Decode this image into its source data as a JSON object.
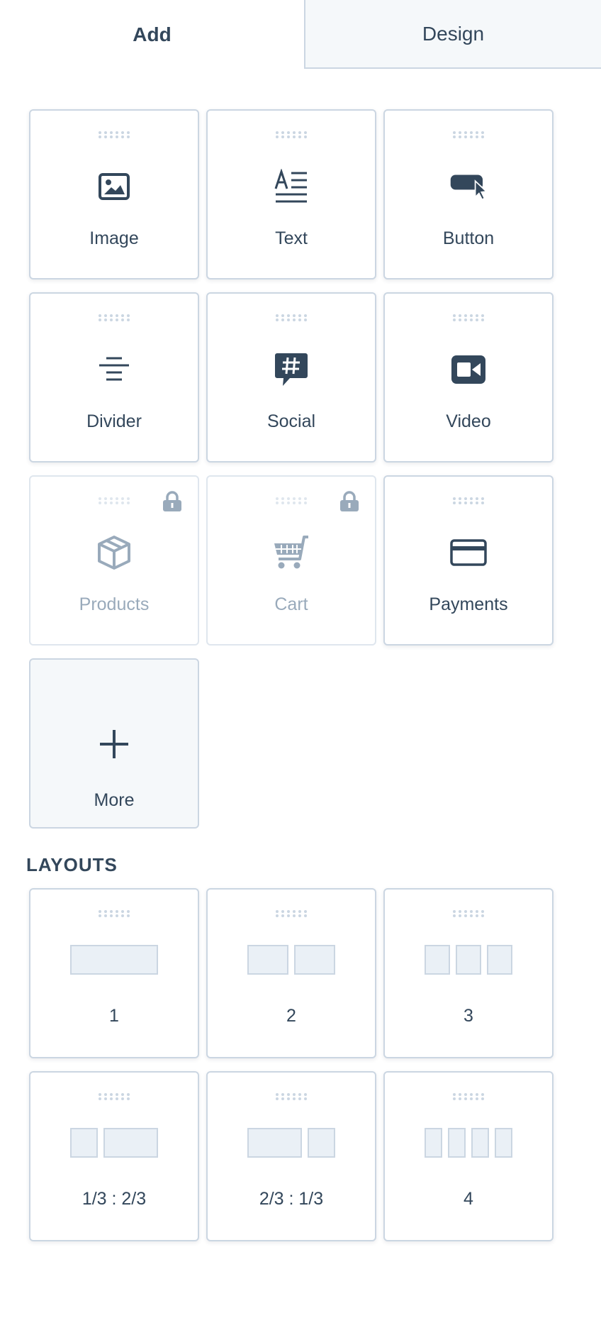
{
  "tabs": [
    {
      "label": "Add",
      "active": true
    },
    {
      "label": "Design",
      "active": false
    }
  ],
  "modules": [
    {
      "label": "Image",
      "icon": "image-icon",
      "locked": false
    },
    {
      "label": "Text",
      "icon": "text-icon",
      "locked": false
    },
    {
      "label": "Button",
      "icon": "button-icon",
      "locked": false
    },
    {
      "label": "Divider",
      "icon": "divider-icon",
      "locked": false
    },
    {
      "label": "Social",
      "icon": "social-hashtag-icon",
      "locked": false
    },
    {
      "label": "Video",
      "icon": "video-camera-icon",
      "locked": false
    },
    {
      "label": "Products",
      "icon": "product-box-icon",
      "locked": true
    },
    {
      "label": "Cart",
      "icon": "shopping-cart-icon",
      "locked": true
    },
    {
      "label": "Payments",
      "icon": "credit-card-icon",
      "locked": false
    }
  ],
  "more": {
    "label": "More",
    "icon": "plus-icon"
  },
  "layouts_title": "LAYOUTS",
  "layouts": [
    {
      "label": "1",
      "columns": [
        1
      ]
    },
    {
      "label": "2",
      "columns": [
        1,
        1
      ]
    },
    {
      "label": "3",
      "columns": [
        1,
        1,
        1
      ]
    },
    {
      "label": "1/3 : 2/3",
      "columns": [
        1,
        2
      ]
    },
    {
      "label": "2/3 : 1/3",
      "columns": [
        2,
        1
      ]
    },
    {
      "label": "4",
      "columns": [
        1,
        1,
        1,
        1
      ]
    }
  ],
  "colors": {
    "text": "#33475b",
    "border": "#cbd6e2",
    "muted": "#99aabb",
    "preview_fill": "#eaf0f6",
    "tab_inactive_bg": "#f5f8fa"
  }
}
